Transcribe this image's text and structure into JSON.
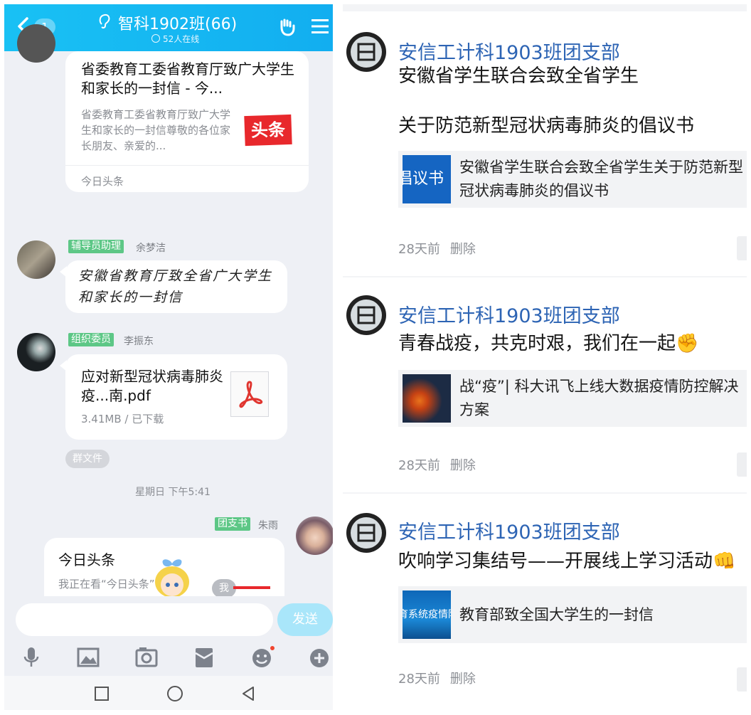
{
  "left": {
    "header": {
      "back_count": "1",
      "title": "智科1902班(66)",
      "online": "52人在线"
    },
    "messages": [
      {
        "type": "news_card",
        "title": "省委教育工委省教育厅致广大学生和家长的一封信 - 今...",
        "description": "省委教育工委省教育厅致广大学生和家长的一封信尊敬的各位家长朋友、亲爱的...",
        "logo_text": "头条",
        "source": "今日头条"
      },
      {
        "type": "text",
        "role": "辅导员助理",
        "sender": "余梦洁",
        "text": "安徽省教育厅致全省广大学生和家长的一封信"
      },
      {
        "type": "file",
        "role": "组织委员",
        "sender": "李振东",
        "file_name": "应对新型冠状病毒肺炎疫...南.pdf",
        "file_meta": "3.41MB / 已下载",
        "tag": "群文件"
      },
      {
        "type": "time",
        "text": "星期日 下午5:41"
      },
      {
        "type": "news_card_self",
        "role": "团支书",
        "sender": "朱雨",
        "title": "今日头条",
        "description": "我正在看“今日头条”",
        "floating_label": "我"
      }
    ],
    "input": {
      "placeholder": "",
      "send_label": "发送"
    },
    "toolbar": [
      "microphone-icon",
      "image-icon",
      "camera-icon",
      "red-packet-icon",
      "emoji-icon",
      "plus-icon"
    ]
  },
  "right": {
    "posts": [
      {
        "author": "安信工计科1903班团支部",
        "lines": [
          "安徽省学生联合会致全省学生",
          "关于防范新型冠状病毒肺炎的倡议书"
        ],
        "link_text": "安徽省学生联合会致全省学生关于防范新型冠状病毒肺炎的倡议书",
        "thumb_text": "倡议书",
        "time": "28天前",
        "action": "删除"
      },
      {
        "author": "安信工计科1903班团支部",
        "lines": [
          "青春战疫，共克时艰，我们在一起✊"
        ],
        "link_text": "战“疫”| 科大讯飞上线大数据疫情防控解决方案",
        "thumb_text": "",
        "time": "28天前",
        "action": "删除"
      },
      {
        "author": "安信工计科1903班团支部",
        "lines": [
          "吹响学习集结号——开展线上学习活动👊"
        ],
        "link_text": "教育部致全国大学生的一封信",
        "thumb_text": "育系统疫情防",
        "time": "28天前",
        "action": "删除"
      }
    ]
  },
  "colors": {
    "header_blue": "#16b8f3",
    "tag_green": "#5dc786",
    "author_blue": "#2d64b4",
    "toutiao_red": "#e8282c"
  }
}
